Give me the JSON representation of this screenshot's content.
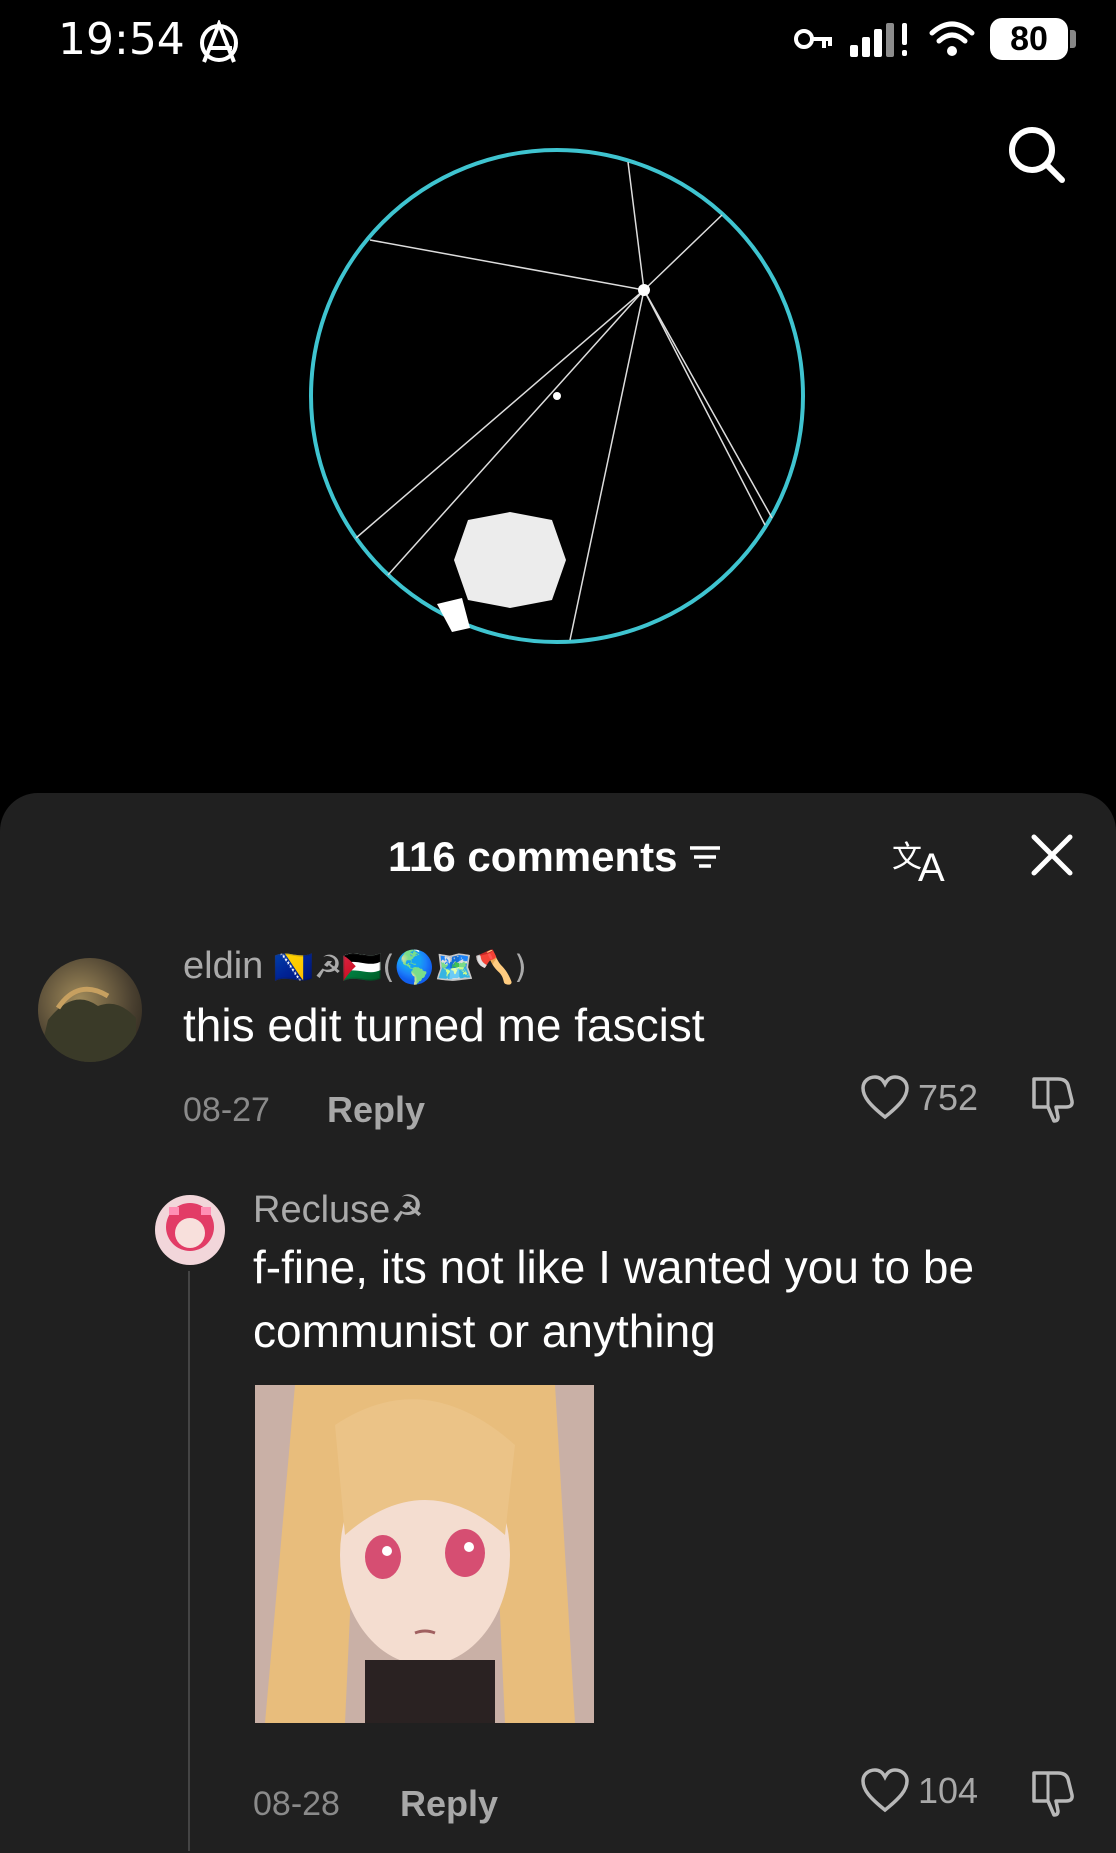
{
  "status_bar": {
    "time": "19:54",
    "battery": "80",
    "icons": [
      "anarchy-icon",
      "key-icon",
      "signal-icon",
      "wifi-icon",
      "battery-icon"
    ]
  },
  "video": {
    "icons": [
      "search-icon"
    ],
    "circle_color": "#3fc4d0"
  },
  "comments_panel": {
    "count_label": "116 comments",
    "icons": [
      "sort-icon",
      "translate-icon",
      "close-icon"
    ],
    "comments": [
      {
        "username": "eldin",
        "username_suffix": "🇧🇦☭🇵🇸(🌎🗺️🪓)",
        "text": "this edit turned me fascist",
        "date": "08-27",
        "reply_label": "Reply",
        "likes": "752"
      }
    ],
    "replies": [
      {
        "username": "Recluse☭",
        "text": "f-fine, its not like I wanted you to be communist or anything",
        "date": "08-28",
        "reply_label": "Reply",
        "likes": "104"
      }
    ]
  },
  "colors": {
    "background": "#000000",
    "sheet": "#202020",
    "muted_text": "#a8a8a8",
    "accent_circle": "#3fc4d0"
  }
}
